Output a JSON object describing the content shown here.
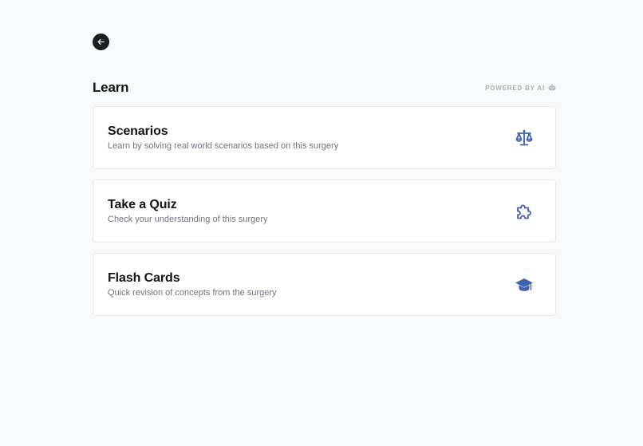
{
  "nav": {
    "back_icon": "arrow-left-icon"
  },
  "header": {
    "title": "Learn",
    "powered_by": "POWERED BY AI",
    "powered_icon": "robot-icon"
  },
  "cards": [
    {
      "title": "Scenarios",
      "description": "Learn by solving real world scenarios based on this surgery",
      "icon": "scale-icon"
    },
    {
      "title": "Take a Quiz",
      "description": "Check your understanding of this surgery",
      "icon": "puzzle-icon"
    },
    {
      "title": "Flash Cards",
      "description": "Quick revision of concepts from the surgery",
      "icon": "graduation-cap-icon"
    }
  ],
  "colors": {
    "background": "#f8f9fb",
    "accent": "#3f63b0",
    "back_button": "#1b1f24"
  }
}
